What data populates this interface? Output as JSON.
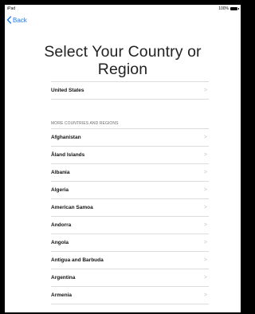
{
  "status_bar": {
    "carrier": "iPad",
    "battery": "100%"
  },
  "nav": {
    "back_label": "Back"
  },
  "title_line1": "Select Your Country or",
  "title_line2": "Region",
  "suggested": [
    {
      "label": "United States"
    }
  ],
  "section_header": "MORE COUNTRIES AND REGIONS",
  "countries": [
    {
      "label": "Afghanistan"
    },
    {
      "label": "Åland Islands"
    },
    {
      "label": "Albania"
    },
    {
      "label": "Algeria"
    },
    {
      "label": "American Samoa"
    },
    {
      "label": "Andorra"
    },
    {
      "label": "Angola"
    },
    {
      "label": "Antigua and Barbuda"
    },
    {
      "label": "Argentina"
    },
    {
      "label": "Armenia"
    }
  ],
  "colors": {
    "accent": "#1a7cf5",
    "separator": "#dcdcdc",
    "chevron": "#c4c4c8"
  },
  "icons": {
    "back": "chevron-left-icon",
    "row_disclosure": "chevron-right-icon",
    "battery": "battery-icon"
  }
}
